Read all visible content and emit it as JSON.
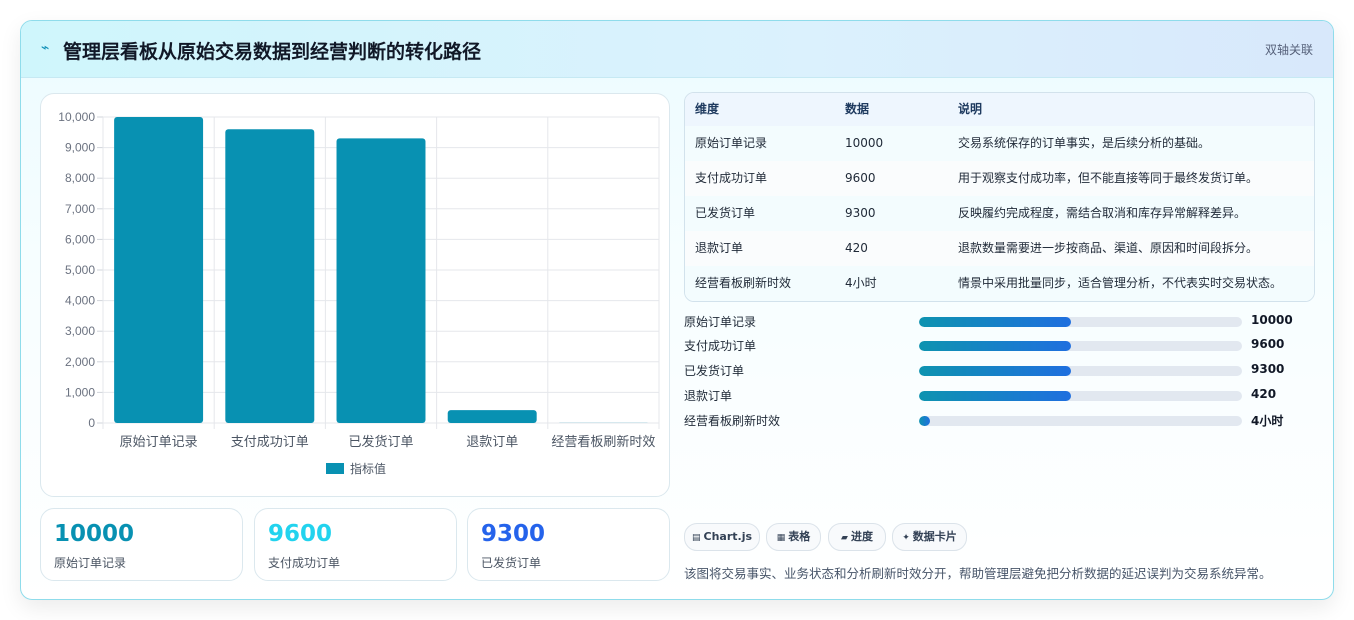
{
  "header": {
    "icon": "lightning-icon",
    "title": "管理层看板从原始交易数据到经营判断的转化路径",
    "tag": "双轴关联"
  },
  "colors": {
    "bar": "#0891b2",
    "kpi1": "#0891b2",
    "kpi2": "#22d3ee",
    "kpi3": "#2563eb"
  },
  "chart_data": {
    "type": "bar",
    "categories": [
      "原始订单记录",
      "支付成功订单",
      "已发货订单",
      "退款订单",
      "经营看板刷新时效"
    ],
    "series": [
      {
        "name": "指标值",
        "values": [
          10000,
          9600,
          9300,
          420,
          4
        ]
      }
    ],
    "ylim": [
      0,
      10000
    ],
    "yticks": [
      "0",
      "1,000",
      "2,000",
      "3,000",
      "4,000",
      "5,000",
      "6,000",
      "7,000",
      "8,000",
      "9,000",
      "10,000"
    ],
    "legend": "bottom",
    "grid": true
  },
  "kpis": [
    {
      "value": "10000",
      "label": "原始订单记录"
    },
    {
      "value": "9600",
      "label": "支付成功订单"
    },
    {
      "value": "9300",
      "label": "已发货订单"
    }
  ],
  "table": {
    "headers": [
      "维度",
      "数据",
      "说明"
    ],
    "rows": [
      [
        "原始订单记录",
        "10000",
        "交易系统保存的订单事实，是后续分析的基础。"
      ],
      [
        "支付成功订单",
        "9600",
        "用于观察支付成功率，但不能直接等同于最终发货订单。"
      ],
      [
        "已发货订单",
        "9300",
        "反映履约完成程度，需结合取消和库存异常解释差异。"
      ],
      [
        "退款订单",
        "420",
        "退款数量需要进一步按商品、渠道、原因和时间段拆分。"
      ],
      [
        "经营看板刷新时效",
        "4小时",
        "情景中采用批量同步，适合管理分析，不代表实时交易状态。"
      ]
    ]
  },
  "progress": [
    {
      "label": "原始订单记录",
      "value": "10000",
      "fill": 0.47
    },
    {
      "label": "支付成功订单",
      "value": "9600",
      "fill": 0.47
    },
    {
      "label": "已发货订单",
      "value": "9300",
      "fill": 0.47
    },
    {
      "label": "退款订单",
      "value": "420",
      "fill": 0.47
    },
    {
      "label": "经营看板刷新时效",
      "value": "4小时",
      "fill": 0.035
    }
  ],
  "chips": [
    {
      "icon": "chart-icon",
      "glyph": "▤",
      "label": "Chart.js"
    },
    {
      "icon": "table-icon",
      "glyph": "▦",
      "label": "表格"
    },
    {
      "icon": "progress-icon",
      "glyph": "▰",
      "label": "进度"
    },
    {
      "icon": "sparkle-icon",
      "glyph": "✦",
      "label": "数据卡片"
    }
  ],
  "footnote": "该图将交易事实、业务状态和分析刷新时效分开，帮助管理层避免把分析数据的延迟误判为交易系统异常。"
}
